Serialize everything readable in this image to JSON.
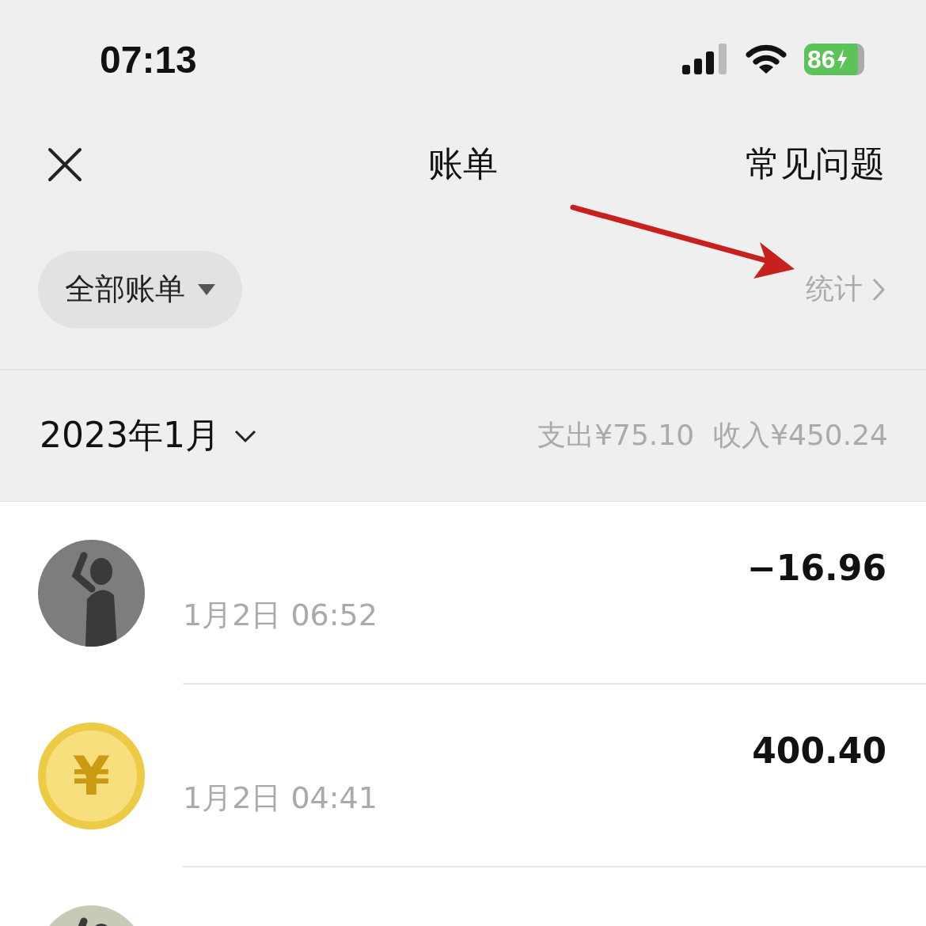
{
  "status_bar": {
    "time": "07:13",
    "battery_text": "86"
  },
  "nav": {
    "title": "账单",
    "right_link": "常见问题"
  },
  "filter": {
    "label": "全部账单",
    "stats_link": "统计"
  },
  "month": {
    "label": "2023年1月",
    "expense": "支出¥75.10",
    "income": "收入¥450.24"
  },
  "transactions": [
    {
      "kind": "picture",
      "time": "1月2日 06:52",
      "amount": "−16.96"
    },
    {
      "kind": "coin",
      "symbol": "¥",
      "time": "1月2日 04:41",
      "amount": "400.40"
    },
    {
      "kind": "picture"
    }
  ]
}
